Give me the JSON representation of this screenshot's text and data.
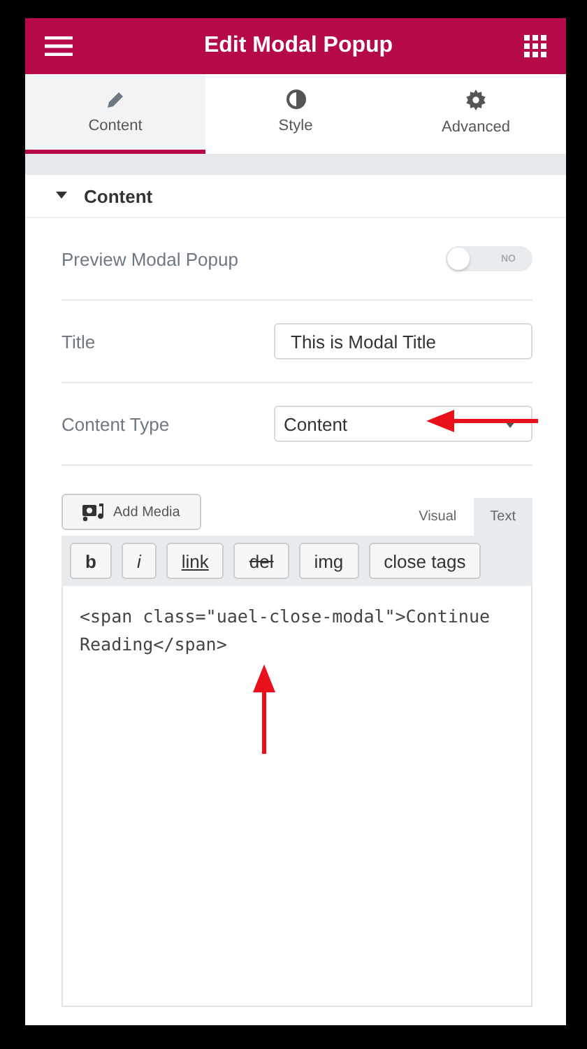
{
  "header": {
    "title": "Edit Modal Popup"
  },
  "tabs": [
    {
      "label": "Content",
      "selected": true
    },
    {
      "label": "Style",
      "selected": false
    },
    {
      "label": "Advanced",
      "selected": false
    }
  ],
  "section": {
    "title": "Content",
    "expanded": true
  },
  "controls": [
    {
      "kind": "switch",
      "label": "Preview Modal Popup",
      "on": false,
      "switch_text": "NO"
    },
    {
      "kind": "text",
      "label": "Title",
      "value": "This is Modal Title"
    },
    {
      "kind": "select",
      "label": "Content Type",
      "value": "Content",
      "annotated": true
    }
  ],
  "editor": {
    "add_media": "Add Media",
    "modes": [
      {
        "label": "Visual",
        "selected": false
      },
      {
        "label": "Text",
        "selected": true
      }
    ],
    "quicktags": [
      {
        "label": "b",
        "kind": "bold"
      },
      {
        "label": "i",
        "kind": "italic"
      },
      {
        "label": "link",
        "kind": "link"
      },
      {
        "label": "del",
        "kind": "del"
      },
      {
        "label": "img",
        "kind": "plain"
      },
      {
        "label": "close tags",
        "kind": "plain"
      }
    ],
    "content": "<span class=\"uael-close-modal\">Continue Reading</span>",
    "annotated": true
  }
}
